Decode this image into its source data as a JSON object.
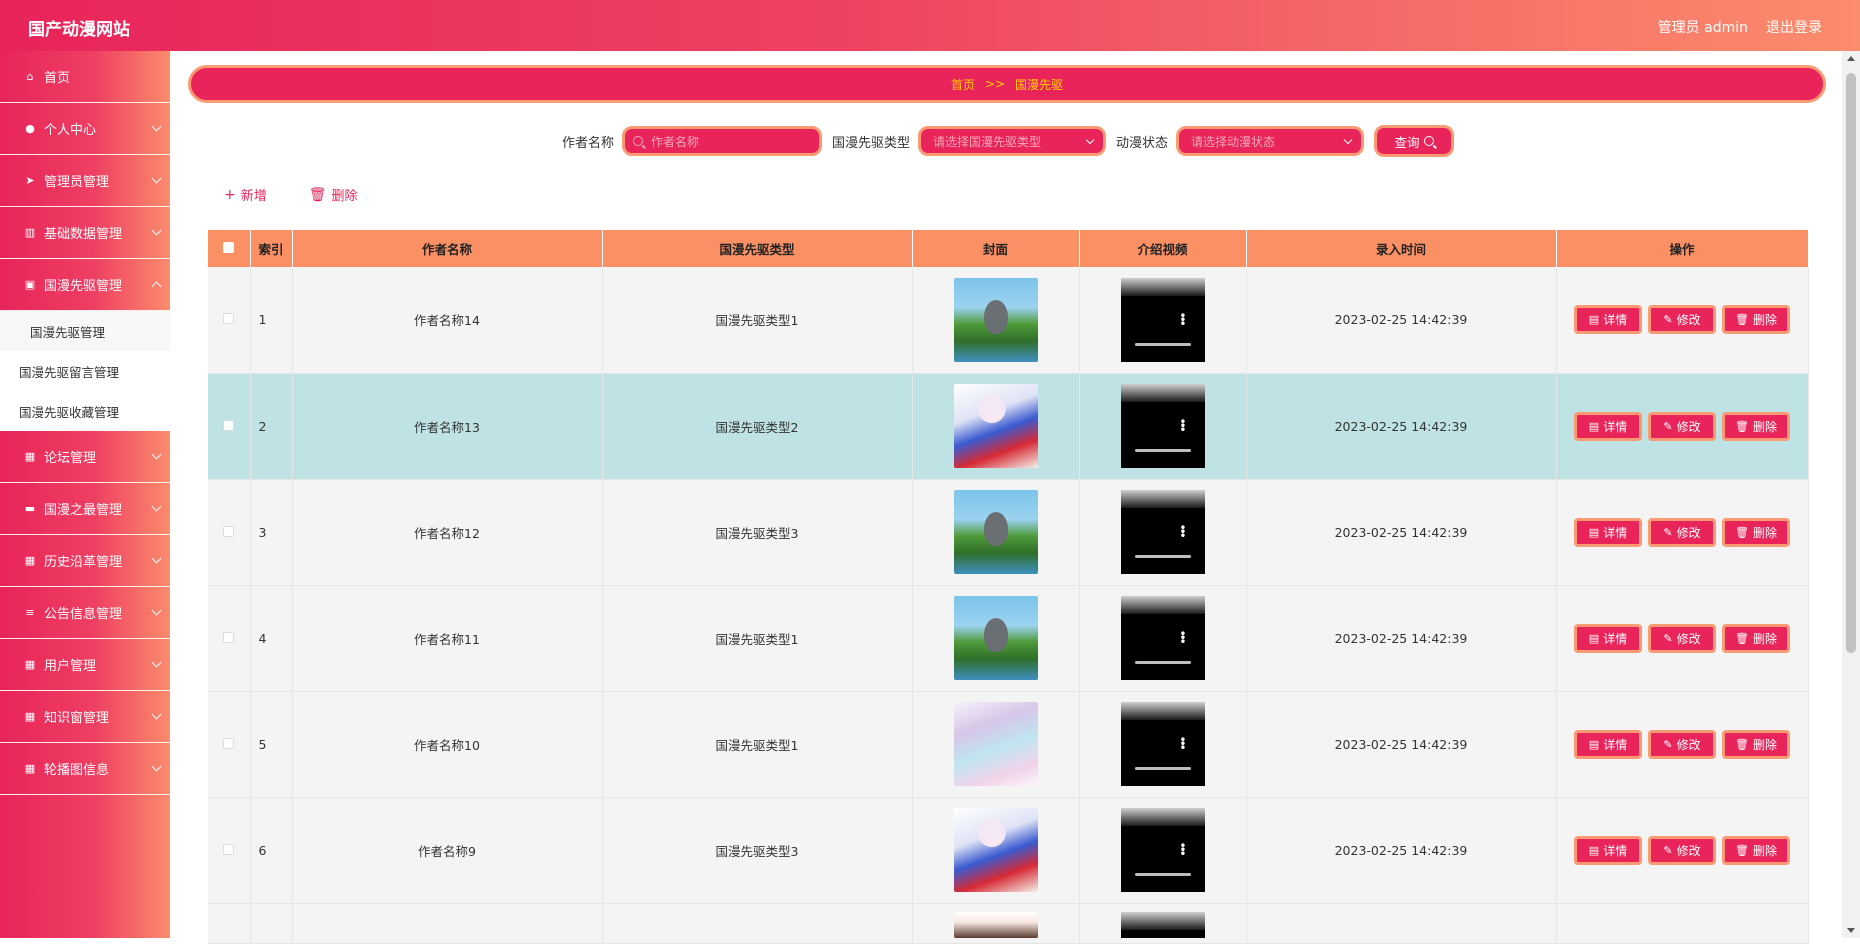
{
  "header": {
    "logo": "国产动漫网站",
    "admin": "管理员 admin",
    "logout": "退出登录"
  },
  "sidebar": {
    "items": [
      {
        "label": "首页",
        "icon": "home-icon"
      },
      {
        "label": "个人中心",
        "icon": "user-icon"
      },
      {
        "label": "管理员管理",
        "icon": "send-icon"
      },
      {
        "label": "基础数据管理",
        "icon": "chart-icon"
      },
      {
        "label": "国漫先驱管理",
        "icon": "clipboard-icon"
      },
      {
        "label": "论坛管理",
        "icon": "grid-icon"
      },
      {
        "label": "国漫之最管理",
        "icon": "ticket-icon"
      },
      {
        "label": "历史沿革管理",
        "icon": "grid-icon"
      },
      {
        "label": "公告信息管理",
        "icon": "list-icon"
      },
      {
        "label": "用户管理",
        "icon": "grid-icon"
      },
      {
        "label": "知识窗管理",
        "icon": "grid-icon"
      },
      {
        "label": "轮播图信息",
        "icon": "grid-icon"
      }
    ],
    "submenu": [
      "国漫先驱管理",
      "国漫先驱留言管理",
      "国漫先驱收藏管理"
    ]
  },
  "breadcrumb": {
    "home": "首页",
    "sep": ">>",
    "current": "国漫先驱"
  },
  "search": {
    "author_label": "作者名称",
    "author_placeholder": "作者名称",
    "type_label": "国漫先驱类型",
    "type_placeholder": "请选择国漫先驱类型",
    "status_label": "动漫状态",
    "status_placeholder": "请选择动漫状态",
    "query_label": "查询"
  },
  "actions": {
    "add": "新增",
    "delete": "删除"
  },
  "table": {
    "headers": [
      "索引",
      "作者名称",
      "国漫先驱类型",
      "封面",
      "介绍视频",
      "录入时间",
      "操作"
    ],
    "rows": [
      {
        "index": "1",
        "author": "作者名称14",
        "type": "国漫先驱类型1",
        "time": "2023-02-25 14:42:39",
        "cover": "totoro"
      },
      {
        "index": "2",
        "author": "作者名称13",
        "type": "国漫先驱类型2",
        "time": "2023-02-25 14:42:39",
        "cover": "girl-red"
      },
      {
        "index": "3",
        "author": "作者名称12",
        "type": "国漫先驱类型3",
        "time": "2023-02-25 14:42:39",
        "cover": "totoro"
      },
      {
        "index": "4",
        "author": "作者名称11",
        "type": "国漫先驱类型1",
        "time": "2023-02-25 14:42:39",
        "cover": "totoro"
      },
      {
        "index": "5",
        "author": "作者名称10",
        "type": "国漫先驱类型1",
        "time": "2023-02-25 14:42:39",
        "cover": "fairy"
      },
      {
        "index": "6",
        "author": "作者名称9",
        "type": "国漫先驱类型3",
        "time": "2023-02-25 14:42:39",
        "cover": "girl-red"
      }
    ],
    "btn_detail": "详情",
    "btn_edit": "修改",
    "btn_delete": "删除"
  },
  "colors": {
    "primary": "#e8245a",
    "accent_border": "#fa9a73",
    "header_bg": "#fb9065",
    "highlight_row": "#bfe2e4",
    "breadcrumb_text": "#ffd200"
  }
}
